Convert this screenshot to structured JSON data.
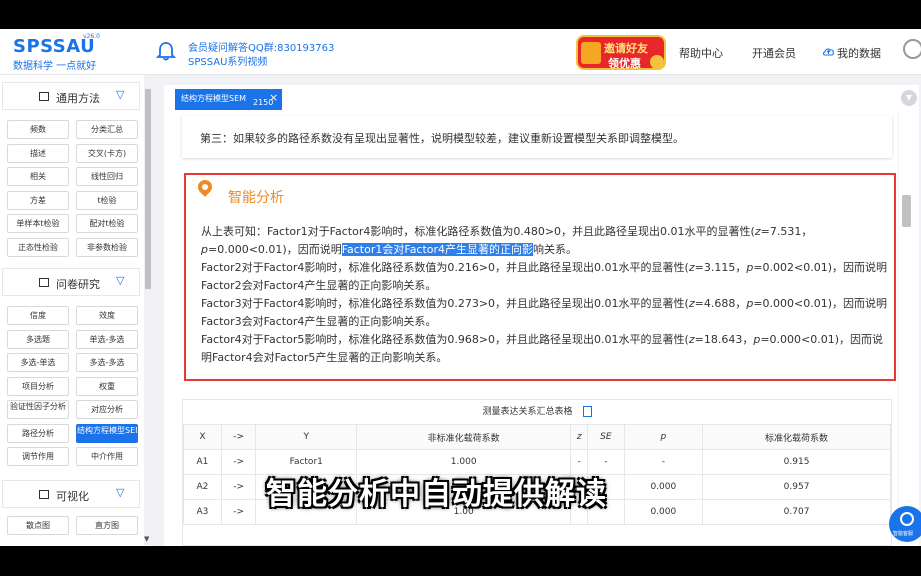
{
  "header": {
    "logo": "SPSSAU",
    "logo_version": "v26.0",
    "logo_subtitle": "数据科学 一点就好",
    "qq_text": "会员疑问解答QQ群:830193763",
    "video_text": "SPSSAU系列视频",
    "promo_line1": "邀请好友",
    "promo_line2": "领优惠",
    "nav_help": "帮助中心",
    "nav_member": "开通会员",
    "nav_data": "我的数据"
  },
  "sidebar": {
    "section1": "通用方法",
    "section1_items": [
      "频数",
      "分类汇总",
      "描述",
      "交叉(卡方)",
      "相关",
      "线性回归",
      "方差",
      "t检验",
      "单样本t检验",
      "配对t检验",
      "正态性检验",
      "非参数检验"
    ],
    "section2": "问卷研究",
    "section2_items": [
      "信度",
      "效度",
      "多选题",
      "单选-多选",
      "多选-单选",
      "多选-多选",
      "项目分析",
      "权重",
      "验证性因子分析",
      "对应分析",
      "路径分析",
      "结构方程模型SEM",
      "调节作用",
      "中介作用"
    ],
    "section3": "可视化",
    "section3_items": [
      "散点图",
      "直方图"
    ]
  },
  "tab": {
    "label": "结构方程模型SEM",
    "close": "×",
    "badge": "2150"
  },
  "note_text": "第三：如果较多的路径系数没有呈现出显著性，说明模型较差，建议重新设置模型关系即调整模型。",
  "analysis": {
    "title": "智能分析",
    "p1_a": "从上表可知：Factor1对于Factor4影响时，标准化路径系数值为0.480>0，并且此路径呈现出0.01水平的显著性(",
    "p1_b": "z",
    "p1_c": "=7.531，",
    "p1_d": "p",
    "p1_e": "=0.000<0.01)，因而说明",
    "p1_hl": "Factor1会对Factor4产生显著的正向影",
    "p1_f": "响关系。",
    "p2_a": "Factor2对于Factor4影响时，标准化路径系数值为0.216>0，并且此路径呈现出0.01水平的显著性(",
    "p2_b": "z",
    "p2_c": "=3.115，",
    "p2_d": "p",
    "p2_e": "=0.002<0.01)，因而说明Factor2会对Factor4产生显著的正向影响关系。",
    "p3_a": "Factor3对于Factor4影响时，标准化路径系数值为0.273>0，并且此路径呈现出0.01水平的显著性(",
    "p3_b": "z",
    "p3_c": "=4.688，",
    "p3_d": "p",
    "p3_e": "=0.000<0.01)，因而说明Factor3会对Factor4产生显著的正向影响关系。",
    "p4_a": "Factor4对于Factor5影响时，标准化路径系数值为0.968>0，并且此路径呈现出0.01水平的显著性(",
    "p4_b": "z",
    "p4_c": "=18.643，",
    "p4_d": "p",
    "p4_e": "=0.000<0.01)，因而说明Factor4会对Factor5产生显著的正向影响关系。"
  },
  "table": {
    "title": "测量表达关系汇总表格",
    "headers": [
      "X",
      "->",
      "Y",
      "非标准化载荷系数",
      "z",
      "SE",
      "p",
      "标准化载荷系数"
    ],
    "rows": [
      [
        "A1",
        "->",
        "Factor1",
        "1.000",
        "-",
        "-",
        "-",
        "0.915"
      ],
      [
        "A2",
        "->",
        "",
        "",
        "",
        "",
        "0.000",
        "0.957"
      ],
      [
        "A3",
        "->",
        "",
        "1.00",
        "",
        "",
        "0.000",
        "0.707"
      ]
    ]
  },
  "caption": "智能分析中自动提供解读",
  "help_label": "智能客服"
}
